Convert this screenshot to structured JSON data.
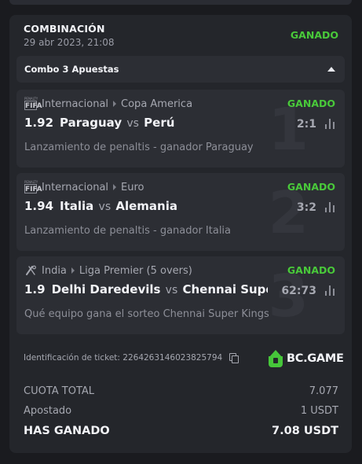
{
  "header": {
    "title": "COMBINACIÓN",
    "date": "29 abr 2023, 21:08",
    "status": "GANADO"
  },
  "combo": {
    "label": "Combo 3 Apuestas"
  },
  "bets": [
    {
      "number": "1",
      "game_icon": "fifa-icon",
      "category": "Internacional",
      "league": "Copa America",
      "status": "GANADO",
      "odds": "1.92",
      "team_home": "Paraguay",
      "vs": "vs",
      "team_away": "Perú",
      "score": "2:1",
      "market": "Lanzamiento de penaltis - ganador Paraguay"
    },
    {
      "number": "2",
      "game_icon": "fifa-icon",
      "category": "Internacional",
      "league": "Euro",
      "status": "GANADO",
      "odds": "1.94",
      "team_home": "Italia",
      "vs": "vs",
      "team_away": "Alemania",
      "score": "3:2",
      "market": "Lanzamiento de penaltis - ganador Italia"
    },
    {
      "number": "3",
      "game_icon": "cricket-icon",
      "category": "India",
      "league": "Liga Premier (5 overs)",
      "status": "GANADO",
      "odds": "1.9",
      "team_home": "Delhi Daredevils",
      "vs": "vs",
      "team_away": "Chennai Super Kin",
      "score": "62:73",
      "market": "Qué equipo gana el sorteo Chennai Super Kings"
    }
  ],
  "ticket": {
    "label": "Identificación de ticket:",
    "id": "2264263146023825794"
  },
  "brand": {
    "name": "BC.GAME",
    "color": "#46c63a"
  },
  "summary": {
    "total_odds_label": "CUOTA TOTAL",
    "total_odds_value": "7.077",
    "staked_label": "Apostado",
    "staked_value": "1 USDT",
    "won_label": "HAS GANADO",
    "won_value": "7.08 USDT"
  },
  "colors": {
    "win_green": "#49c93a",
    "card_bg": "#24262b",
    "page_bg": "#1a1b1f"
  }
}
